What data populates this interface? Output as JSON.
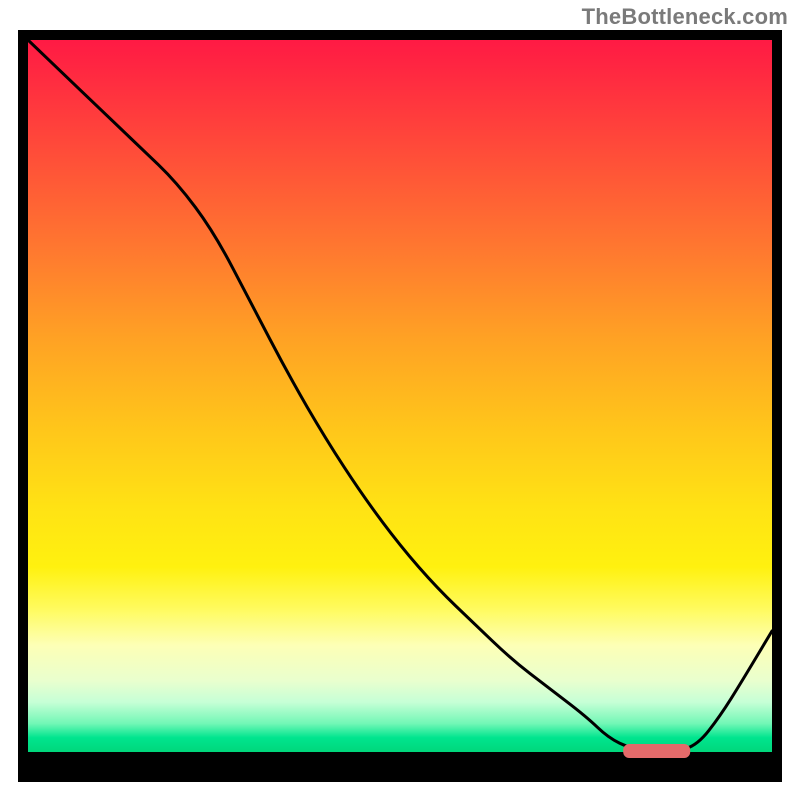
{
  "attribution": "TheBottleneck.com",
  "chart_data": {
    "type": "line",
    "title": "",
    "xlabel": "",
    "ylabel": "",
    "xlim": [
      0,
      100
    ],
    "ylim": [
      0,
      100
    ],
    "series": [
      {
        "name": "bottleneck-curve",
        "x": [
          0,
          5,
          10,
          15,
          20,
          25,
          30,
          35,
          40,
          45,
          50,
          55,
          60,
          65,
          70,
          75,
          78,
          81,
          84,
          87,
          90,
          93,
          96,
          100
        ],
        "y": [
          100,
          95,
          90,
          85,
          80,
          73,
          63,
          53,
          44,
          36,
          29,
          23,
          18,
          13,
          9,
          5,
          2,
          0.5,
          0,
          0,
          1,
          5,
          10,
          17
        ]
      }
    ],
    "annotations": [
      {
        "name": "optimal-marker",
        "x_start": 80,
        "x_end": 89,
        "y": 0
      }
    ]
  }
}
